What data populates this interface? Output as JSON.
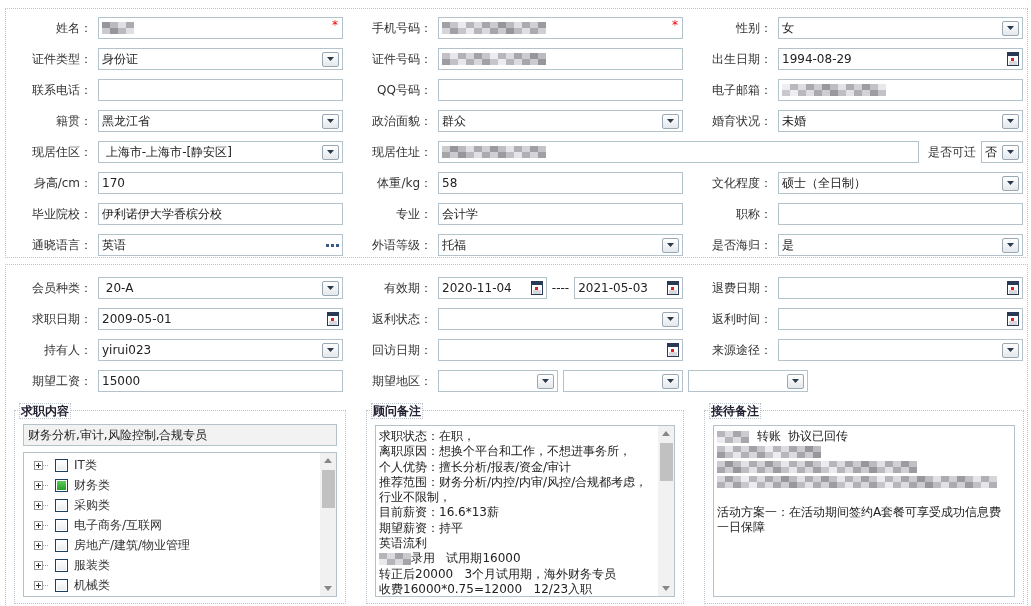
{
  "sections": [
    {
      "rows": [
        [
          {
            "label": "姓名：",
            "fields": [
              {
                "kind": "text",
                "redacted": true,
                "required_mark": "*"
              }
            ]
          },
          {
            "label": "手机号码：",
            "fields": [
              {
                "kind": "text",
                "redacted": true,
                "required_mark": "*"
              }
            ]
          },
          {
            "label": "性别：",
            "fields": [
              {
                "kind": "select",
                "value": "女"
              }
            ]
          }
        ],
        [
          {
            "label": "证件类型：",
            "fields": [
              {
                "kind": "select",
                "value": "身份证"
              }
            ]
          },
          {
            "label": "证件号码：",
            "fields": [
              {
                "kind": "text",
                "redacted": true
              }
            ]
          },
          {
            "label": "出生日期：",
            "fields": [
              {
                "kind": "date",
                "value": "1994-08-29"
              }
            ]
          }
        ],
        [
          {
            "label": "联系电话：",
            "fields": [
              {
                "kind": "text"
              }
            ]
          },
          {
            "label": "QQ号码：",
            "fields": [
              {
                "kind": "text"
              }
            ]
          },
          {
            "label": "电子邮箱：",
            "fields": [
              {
                "kind": "text",
                "redacted": true
              }
            ]
          }
        ],
        [
          {
            "label": "籍贯：",
            "fields": [
              {
                "kind": "select",
                "value": "黑龙江省"
              }
            ]
          },
          {
            "label": "政治面貌：",
            "fields": [
              {
                "kind": "select",
                "value": "群众"
              }
            ]
          },
          {
            "label": "婚育状况：",
            "fields": [
              {
                "kind": "select",
                "value": "未婚"
              }
            ]
          }
        ],
        [
          {
            "label": "现居住区：",
            "fields": [
              {
                "kind": "select",
                "value": " 上海市-上海市-[静安区]"
              }
            ]
          },
          {
            "label": "现居住址：",
            "wide": true,
            "fields": [
              {
                "kind": "text",
                "redacted": true
              },
              {
                "kind": "inline_label",
                "value": "是否可迁"
              },
              {
                "kind": "select",
                "value": "否"
              }
            ]
          }
        ],
        [
          {
            "label": "身高/cm：",
            "fields": [
              {
                "kind": "text",
                "value": "170"
              }
            ]
          },
          {
            "label": "体重/kg：",
            "fields": [
              {
                "kind": "text",
                "value": "58"
              }
            ]
          },
          {
            "label": "文化程度：",
            "fields": [
              {
                "kind": "select",
                "value": "硕士（全日制）"
              }
            ]
          }
        ],
        [
          {
            "label": "毕业院校：",
            "fields": [
              {
                "kind": "text",
                "value": "伊利诺伊大学香槟分校"
              }
            ]
          },
          {
            "label": "专业：",
            "fields": [
              {
                "kind": "text",
                "value": "会计学"
              }
            ]
          },
          {
            "label": "职称：",
            "fields": [
              {
                "kind": "text"
              }
            ]
          }
        ],
        [
          {
            "label": "通晓语言：",
            "fields": [
              {
                "kind": "lookup",
                "value": "英语"
              }
            ]
          },
          {
            "label": "外语等级：",
            "fields": [
              {
                "kind": "select",
                "value": "托福"
              }
            ]
          },
          {
            "label": "是否海归：",
            "fields": [
              {
                "kind": "select",
                "value": "是"
              }
            ]
          }
        ]
      ]
    },
    {
      "rows": [
        [
          {
            "label": "会员种类：",
            "fields": [
              {
                "kind": "select",
                "value": " 20-A"
              }
            ]
          },
          {
            "label": "有效期：",
            "fields": [
              {
                "kind": "date",
                "value": "2020-11-04"
              },
              {
                "kind": "dash",
                "value": "----"
              },
              {
                "kind": "date",
                "value": "2021-05-03"
              }
            ]
          },
          {
            "label": "退费日期：",
            "fields": [
              {
                "kind": "date"
              }
            ]
          }
        ],
        [
          {
            "label": "求职日期：",
            "fields": [
              {
                "kind": "date",
                "value": "2009-05-01"
              }
            ]
          },
          {
            "label": "返利状态：",
            "fields": [
              {
                "kind": "select"
              }
            ]
          },
          {
            "label": "返利时间：",
            "fields": [
              {
                "kind": "date"
              }
            ]
          }
        ],
        [
          {
            "label": "持有人：",
            "fields": [
              {
                "kind": "select",
                "value": "yirui023"
              }
            ]
          },
          {
            "label": "回访日期：",
            "fields": [
              {
                "kind": "date"
              }
            ]
          },
          {
            "label": "来源途径：",
            "fields": [
              {
                "kind": "select"
              }
            ]
          }
        ],
        [
          {
            "label": "期望工资：",
            "fields": [
              {
                "kind": "text",
                "value": "15000"
              }
            ]
          },
          {
            "label": "期望地区：",
            "wide": true,
            "fields": [
              {
                "kind": "select"
              },
              {
                "kind": "select"
              },
              {
                "kind": "select"
              }
            ]
          }
        ]
      ]
    }
  ],
  "job_panel": {
    "legend": "求职内容",
    "summary": "财务分析,审计,风险控制,合规专员",
    "categories": [
      {
        "label": "IT类",
        "checked": false
      },
      {
        "label": "财务类",
        "checked": true
      },
      {
        "label": "采购类",
        "checked": false
      },
      {
        "label": "电子商务/互联网",
        "checked": false
      },
      {
        "label": "房地产/建筑/物业管理",
        "checked": false
      },
      {
        "label": "服装类",
        "checked": false
      },
      {
        "label": "机械类",
        "checked": false
      }
    ]
  },
  "consultant_notes": {
    "legend": "顾问备注",
    "lines": [
      {
        "kind": "text",
        "text": "求职状态：在职，"
      },
      {
        "kind": "text",
        "text": "离职原因：想换个平台和工作，不想进事务所，"
      },
      {
        "kind": "text",
        "text": "个人优势：擅长分析/报表/资金/审计"
      },
      {
        "kind": "text",
        "text": "推荐范围：财务分析/内控/内审/风控/合规都考虑，"
      },
      {
        "kind": "text",
        "text": "行业不限制，"
      },
      {
        "kind": "text",
        "text": "目前薪资：16.6*13薪"
      },
      {
        "kind": "text",
        "text": "期望薪资：持平"
      },
      {
        "kind": "text",
        "text": "英语流利"
      },
      {
        "kind": "redacted",
        "text": "录用   试用期16000"
      },
      {
        "kind": "text",
        "text": "转正后20000   3个月试用期，海外财务专员"
      },
      {
        "kind": "text",
        "text": "收费16000*0.75=12000   12/23入职"
      }
    ]
  },
  "reception_notes": {
    "legend": "接待备注",
    "lines": [
      {
        "kind": "redacted",
        "text": "  转账  协议已回传"
      },
      {
        "kind": "redacted"
      },
      {
        "kind": "redacted"
      },
      {
        "kind": "redacted"
      },
      {
        "kind": "blank"
      },
      {
        "kind": "text",
        "text": "活动方案一：在活动期间签约A套餐可享受成功信息费一日保障"
      }
    ]
  }
}
